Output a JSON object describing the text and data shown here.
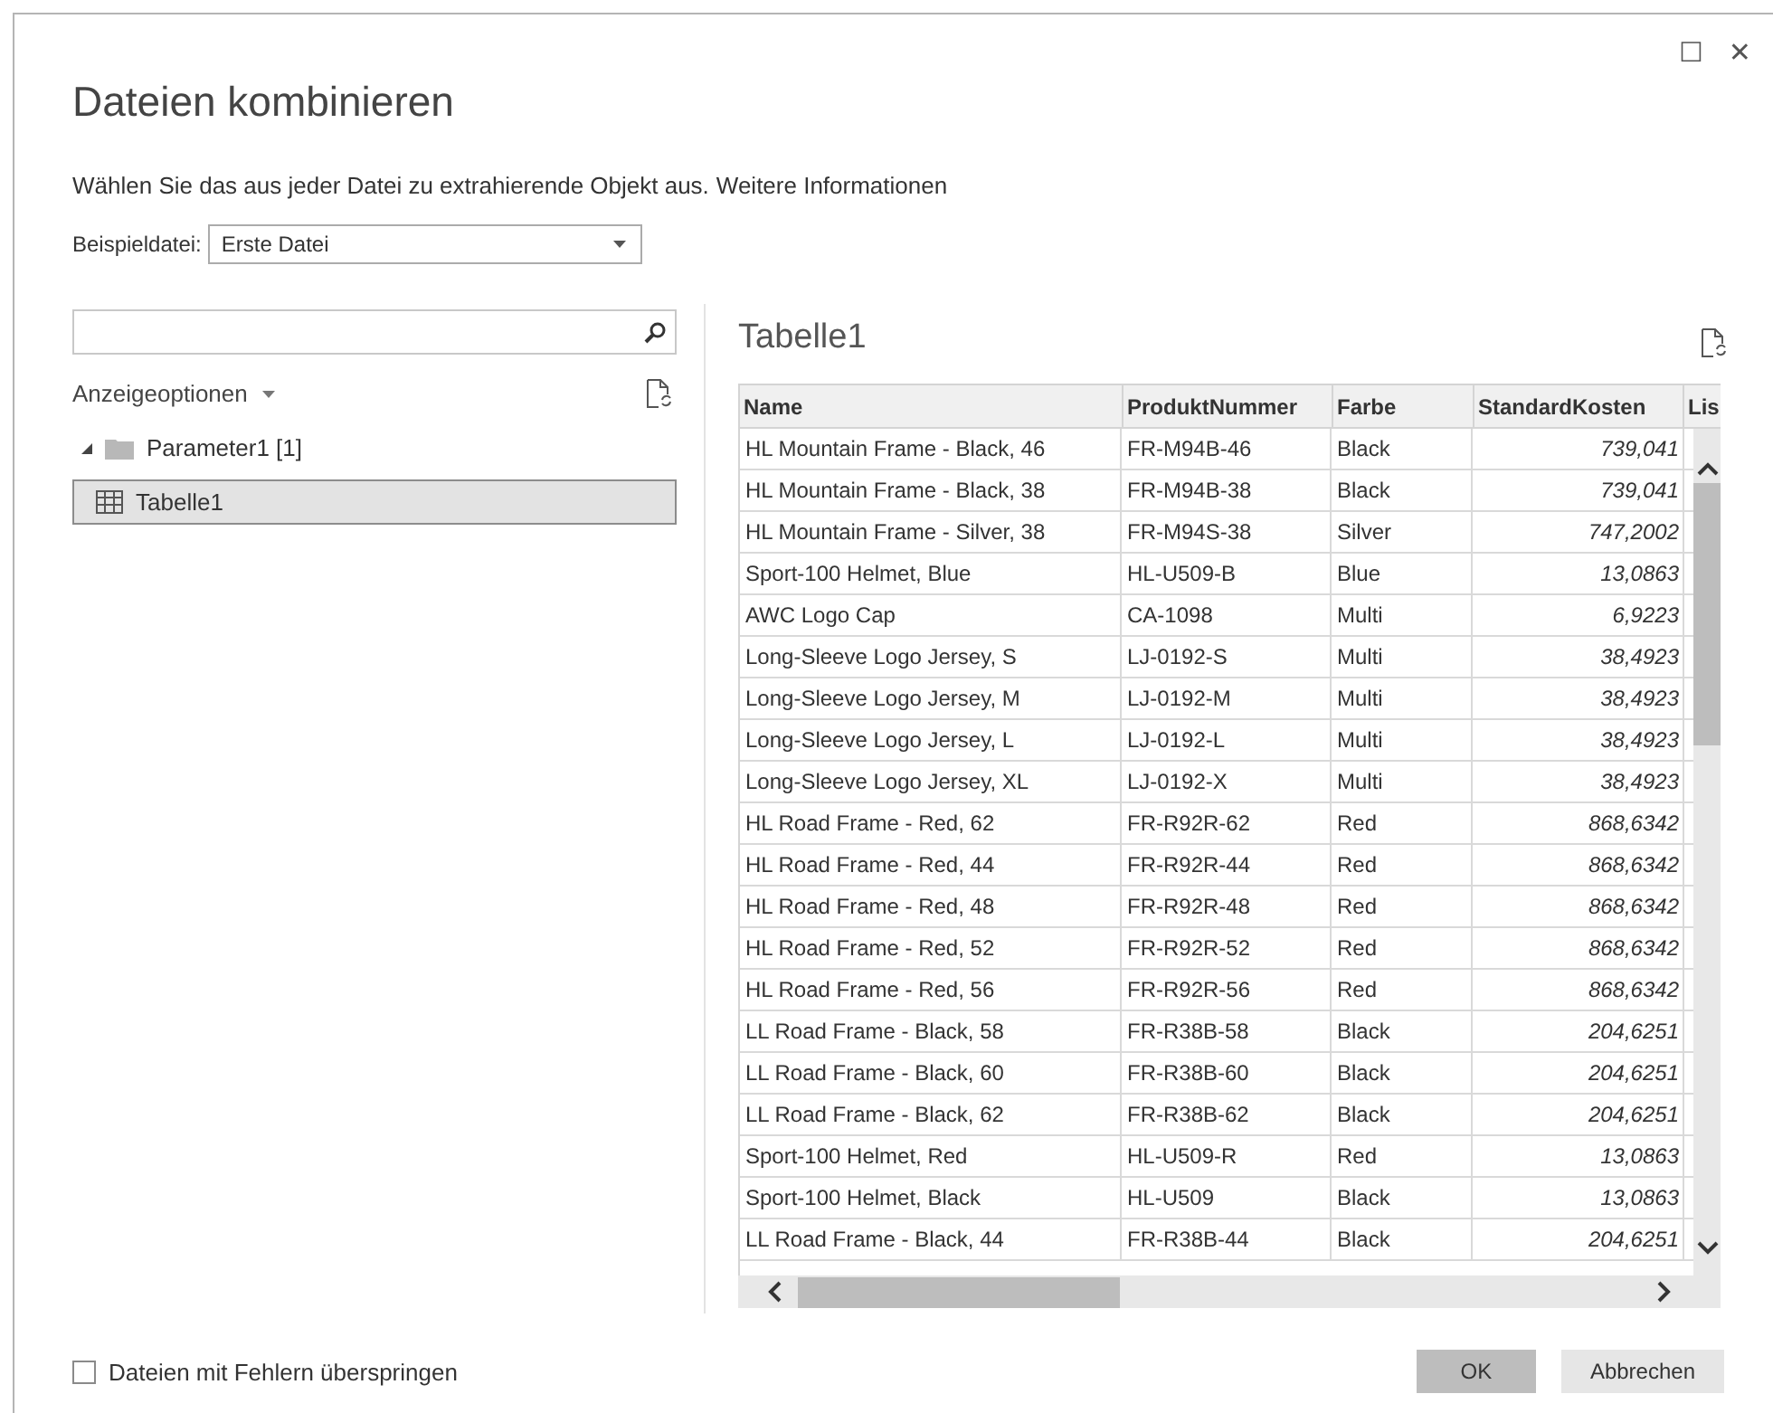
{
  "window": {
    "title": "Dateien kombinieren",
    "maximize_glyph": "☐",
    "close_glyph": "✕"
  },
  "instruction": "Wählen Sie das aus jeder Datei zu extrahierende Objekt aus.",
  "learn_more_link": "Weitere Informationen",
  "sample_file": {
    "label": "Beispieldatei:",
    "value": "Erste Datei"
  },
  "navigator": {
    "display_options": "Anzeigeoptionen",
    "tree": [
      {
        "label": "Parameter1 [1]",
        "expanded": true,
        "selected": false,
        "kind": "folder",
        "children": [
          {
            "label": "Tabelle1",
            "selected": true,
            "kind": "table"
          }
        ]
      }
    ]
  },
  "preview": {
    "title": "Tabelle1",
    "columns": [
      "Name",
      "ProduktNummer",
      "Farbe",
      "StandardKosten",
      "Lis"
    ],
    "rows": [
      [
        "HL Mountain Frame - Black, 46",
        "FR-M94B-46",
        "Black",
        "739,041"
      ],
      [
        "HL Mountain Frame - Black, 38",
        "FR-M94B-38",
        "Black",
        "739,041"
      ],
      [
        "HL Mountain Frame - Silver, 38",
        "FR-M94S-38",
        "Silver",
        "747,2002"
      ],
      [
        "Sport-100 Helmet, Blue",
        "HL-U509-B",
        "Blue",
        "13,0863"
      ],
      [
        "AWC Logo Cap",
        "CA-1098",
        "Multi",
        "6,9223"
      ],
      [
        "Long-Sleeve Logo Jersey, S",
        "LJ-0192-S",
        "Multi",
        "38,4923"
      ],
      [
        "Long-Sleeve Logo Jersey, M",
        "LJ-0192-M",
        "Multi",
        "38,4923"
      ],
      [
        "Long-Sleeve Logo Jersey, L",
        "LJ-0192-L",
        "Multi",
        "38,4923"
      ],
      [
        "Long-Sleeve Logo Jersey, XL",
        "LJ-0192-X",
        "Multi",
        "38,4923"
      ],
      [
        "HL Road Frame - Red, 62",
        "FR-R92R-62",
        "Red",
        "868,6342"
      ],
      [
        "HL Road Frame - Red, 44",
        "FR-R92R-44",
        "Red",
        "868,6342"
      ],
      [
        "HL Road Frame - Red, 48",
        "FR-R92R-48",
        "Red",
        "868,6342"
      ],
      [
        "HL Road Frame - Red, 52",
        "FR-R92R-52",
        "Red",
        "868,6342"
      ],
      [
        "HL Road Frame - Red, 56",
        "FR-R92R-56",
        "Red",
        "868,6342"
      ],
      [
        "LL Road Frame - Black, 58",
        "FR-R38B-58",
        "Black",
        "204,6251"
      ],
      [
        "LL Road Frame - Black, 60",
        "FR-R38B-60",
        "Black",
        "204,6251"
      ],
      [
        "LL Road Frame - Black, 62",
        "FR-R38B-62",
        "Black",
        "204,6251"
      ],
      [
        "Sport-100 Helmet, Red",
        "HL-U509-R",
        "Red",
        "13,0863"
      ],
      [
        "Sport-100 Helmet, Black",
        "HL-U509",
        "Black",
        "13,0863"
      ],
      [
        "LL Road Frame - Black, 44",
        "FR-R38B-44",
        "Black",
        "204,6251"
      ]
    ]
  },
  "skip_errors": {
    "label": "Dateien mit Fehlern überspringen",
    "checked": false
  },
  "buttons": [
    {
      "label": "OK",
      "kind": "primary"
    },
    {
      "label": "Abbrechen",
      "kind": "secondary"
    }
  ]
}
